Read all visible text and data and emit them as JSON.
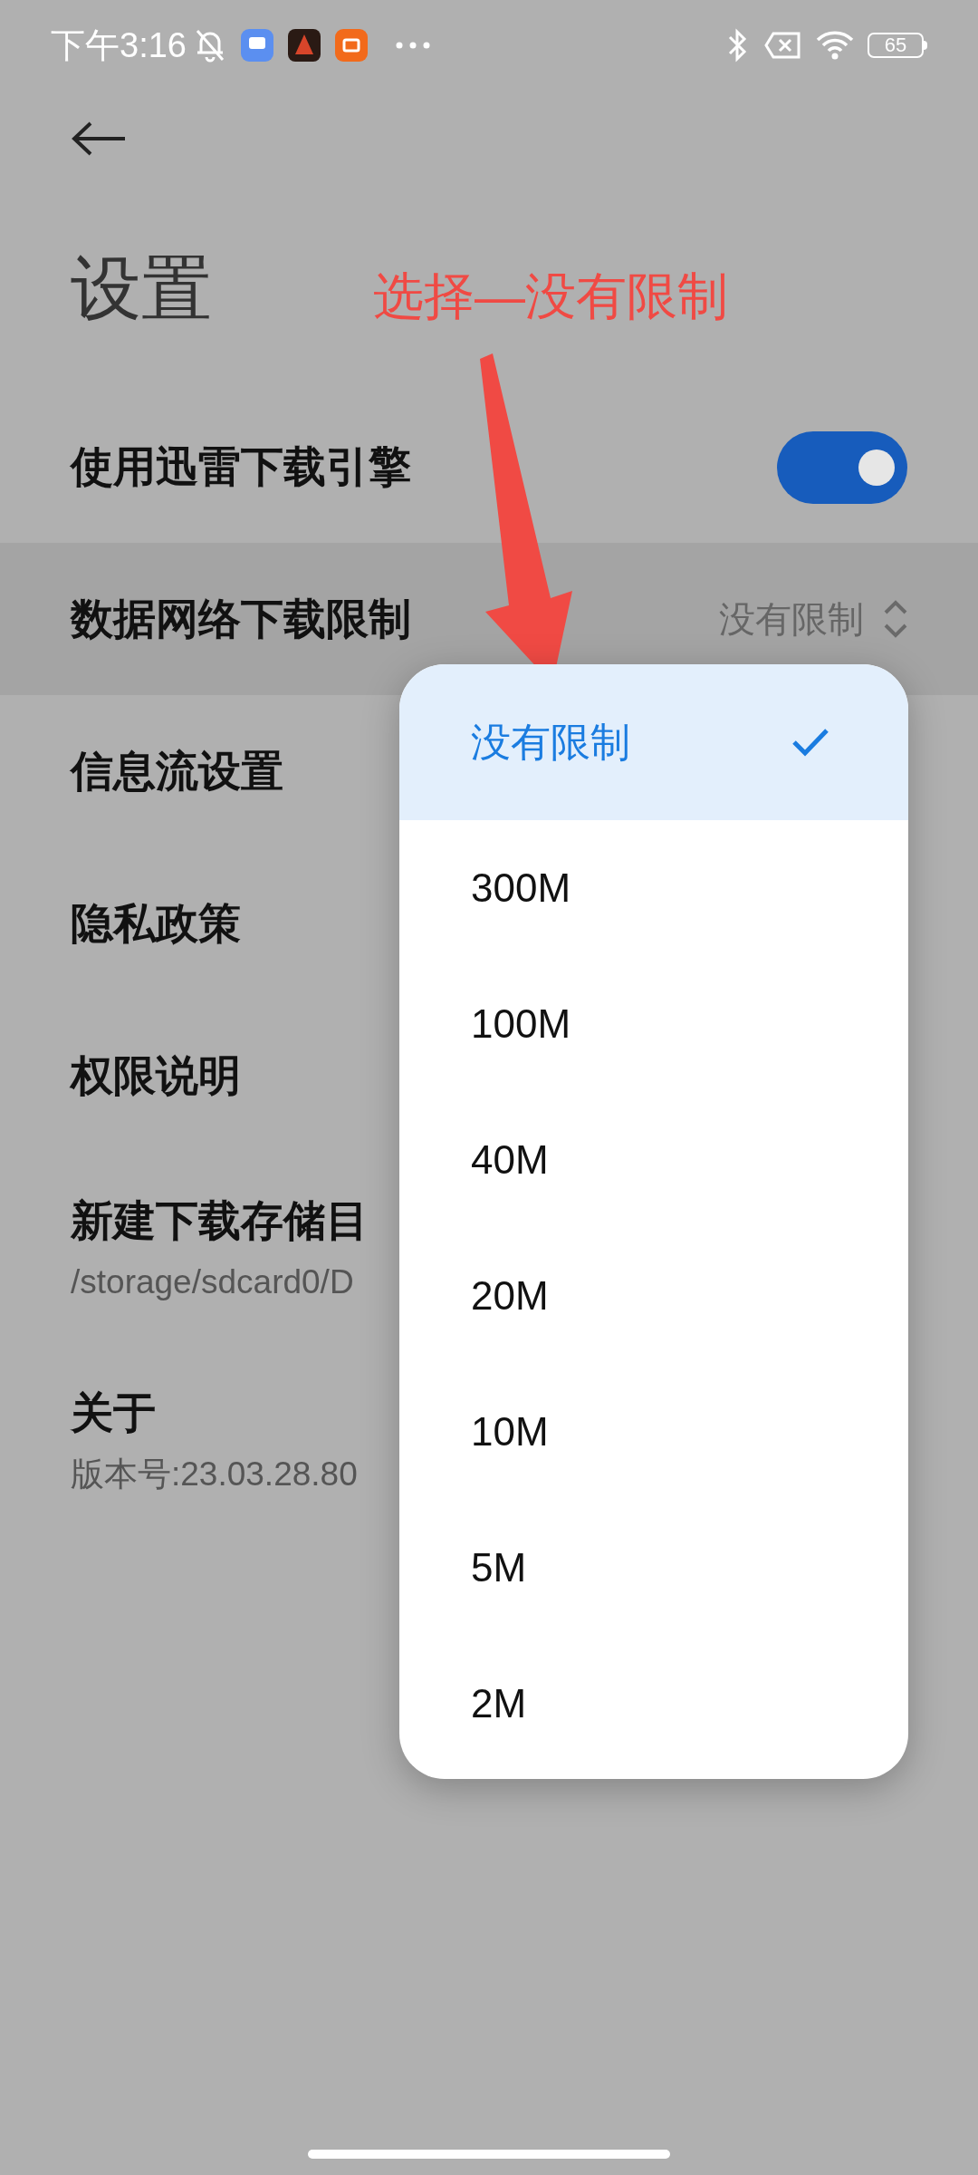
{
  "status_bar": {
    "time": "下午3:16",
    "battery": "65"
  },
  "header": {
    "title": "设置"
  },
  "annotation": {
    "text": "选择—没有限制"
  },
  "settings": [
    {
      "kind": "toggle",
      "label": "使用迅雷下载引擎",
      "on": true
    },
    {
      "kind": "select",
      "label": "数据网络下载限制",
      "value": "没有限制",
      "selected": true
    },
    {
      "kind": "link",
      "label": "信息流设置"
    },
    {
      "kind": "link",
      "label": "隐私政策"
    },
    {
      "kind": "link",
      "label": "权限说明"
    },
    {
      "kind": "detail",
      "label": "新建下载存储目",
      "subtitle": "/storage/sdcard0/D"
    },
    {
      "kind": "detail",
      "label": "关于",
      "subtitle": "版本号:23.03.28.80"
    }
  ],
  "dropdown": {
    "options": [
      {
        "label": "没有限制",
        "selected": true
      },
      {
        "label": "300M",
        "selected": false
      },
      {
        "label": "100M",
        "selected": false
      },
      {
        "label": "40M",
        "selected": false
      },
      {
        "label": "20M",
        "selected": false
      },
      {
        "label": "10M",
        "selected": false
      },
      {
        "label": "5M",
        "selected": false
      },
      {
        "label": "2M",
        "selected": false
      }
    ]
  }
}
